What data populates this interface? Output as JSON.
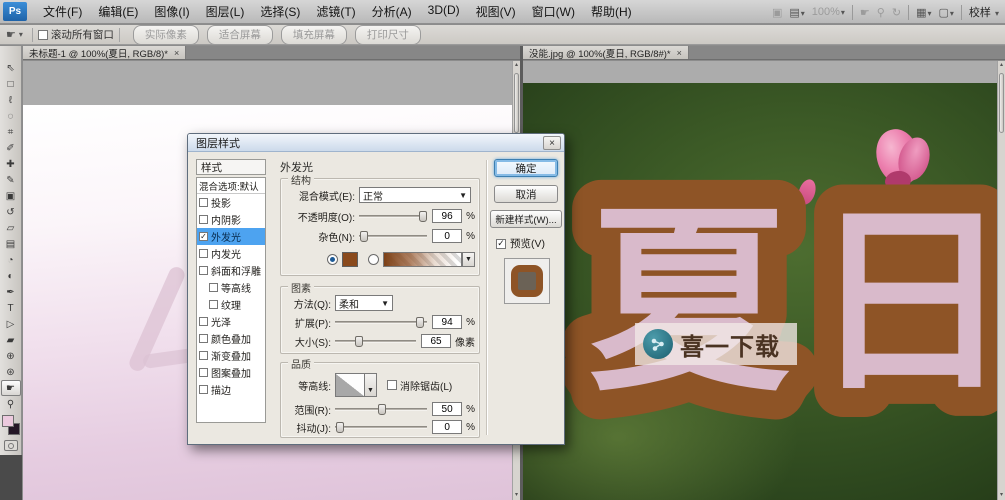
{
  "colors": {
    "selection_blue": "#4da3f0",
    "glow_brown": "#8e5426",
    "art_text_pink": "#d9bacb",
    "foreground_swatch": "#eccade",
    "background_swatch": "#241726"
  },
  "menu": {
    "logo": "Ps",
    "items": [
      "文件(F)",
      "编辑(E)",
      "图像(I)",
      "图层(L)",
      "选择(S)",
      "滤镜(T)",
      "分析(A)",
      "3D(D)",
      "视图(V)",
      "窗口(W)",
      "帮助(H)"
    ],
    "zoom_level": "100%",
    "workspace": "校样"
  },
  "options": {
    "scroll_all": "滚动所有窗口",
    "buttons": [
      "实际像素",
      "适合屏幕",
      "填充屏幕",
      "打印尺寸"
    ]
  },
  "tools": [
    {
      "name": "move-tool",
      "glyph": "⇖"
    },
    {
      "name": "marquee-tool",
      "glyph": "□"
    },
    {
      "name": "lasso-tool",
      "glyph": "ℓ"
    },
    {
      "name": "quick-selection-tool",
      "glyph": "◌"
    },
    {
      "name": "crop-tool",
      "glyph": "⌗"
    },
    {
      "name": "eyedropper-tool",
      "glyph": "✐"
    },
    {
      "name": "spot-healing-tool",
      "glyph": "✚"
    },
    {
      "name": "brush-tool",
      "glyph": "✎"
    },
    {
      "name": "clone-stamp-tool",
      "glyph": "▣"
    },
    {
      "name": "history-brush-tool",
      "glyph": "↺"
    },
    {
      "name": "eraser-tool",
      "glyph": "▱"
    },
    {
      "name": "gradient-tool",
      "glyph": "▤"
    },
    {
      "name": "blur-tool",
      "glyph": "◔"
    },
    {
      "name": "dodge-tool",
      "glyph": "◐"
    },
    {
      "name": "pen-tool",
      "glyph": "✒"
    },
    {
      "name": "type-tool",
      "glyph": "T"
    },
    {
      "name": "path-selection-tool",
      "glyph": "▷"
    },
    {
      "name": "shape-tool",
      "glyph": "▰"
    },
    {
      "name": "3d-rotate-tool",
      "glyph": "⊕"
    },
    {
      "name": "3d-orbit-tool",
      "glyph": "⊛"
    },
    {
      "name": "hand-tool",
      "glyph": "☛",
      "selected": true
    },
    {
      "name": "zoom-tool",
      "glyph": "⚲"
    }
  ],
  "left_doc": {
    "tab_title": "未标题-1 @ 100%(夏日, RGB/8)*",
    "close": "×"
  },
  "right_doc": {
    "tab_title": "没能.jpg @ 100%(夏日, RGB/8#)*",
    "close": "×",
    "art_text": "夏日",
    "watermark_text": "喜一下载"
  },
  "dialog": {
    "title": "图层样式",
    "close": "×",
    "styles_header": "样式",
    "blend_default": "混合选项:默认",
    "styles": [
      {
        "label": "投影",
        "checked": false,
        "selected": false,
        "indent": false
      },
      {
        "label": "内阴影",
        "checked": false,
        "selected": false,
        "indent": false
      },
      {
        "label": "外发光",
        "checked": true,
        "selected": true,
        "indent": false
      },
      {
        "label": "内发光",
        "checked": false,
        "selected": false,
        "indent": false
      },
      {
        "label": "斜面和浮雕",
        "checked": false,
        "selected": false,
        "indent": false
      },
      {
        "label": "等高线",
        "checked": false,
        "selected": false,
        "indent": true
      },
      {
        "label": "纹理",
        "checked": false,
        "selected": false,
        "indent": true
      },
      {
        "label": "光泽",
        "checked": false,
        "selected": false,
        "indent": false
      },
      {
        "label": "颜色叠加",
        "checked": false,
        "selected": false,
        "indent": false
      },
      {
        "label": "渐变叠加",
        "checked": false,
        "selected": false,
        "indent": false
      },
      {
        "label": "图案叠加",
        "checked": false,
        "selected": false,
        "indent": false
      },
      {
        "label": "描边",
        "checked": false,
        "selected": false,
        "indent": false
      }
    ],
    "panel_title": "外发光",
    "structure": {
      "legend": "结构",
      "blend_mode_label": "混合模式(E):",
      "blend_mode_value": "正常",
      "opacity_label": "不透明度(O):",
      "opacity_value": "96",
      "opacity_unit": "%",
      "noise_label": "杂色(N):",
      "noise_value": "0",
      "noise_unit": "%"
    },
    "elements": {
      "legend": "图素",
      "technique_label": "方法(Q):",
      "technique_value": "柔和",
      "spread_label": "扩展(P):",
      "spread_value": "94",
      "spread_unit": "%",
      "size_label": "大小(S):",
      "size_value": "65",
      "size_unit": "像素"
    },
    "quality": {
      "legend": "品质",
      "contour_label": "等高线:",
      "antialias_label": "消除锯齿(L)",
      "range_label": "范围(R):",
      "range_value": "50",
      "range_unit": "%",
      "jitter_label": "抖动(J):",
      "jitter_value": "0",
      "jitter_unit": "%"
    },
    "buttons": {
      "ok": "确定",
      "cancel": "取消",
      "new_style": "新建样式(W)...",
      "preview": "预览(V)"
    }
  }
}
